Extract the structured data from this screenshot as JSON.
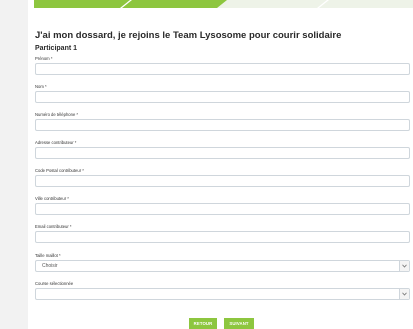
{
  "colors": {
    "accent": "#8dc63f",
    "progress_track": "#eef3e8",
    "page_background": "#f2f2f2",
    "card_background": "#ffffff",
    "input_border": "#cfd6dc"
  },
  "form": {
    "title": "J'ai mon dossard, je rejoins le Team Lysosome pour courir solidaire",
    "participant_heading": "Participant 1",
    "fields": [
      {
        "label": "Prénom *",
        "value": ""
      },
      {
        "label": "Nom *",
        "value": ""
      },
      {
        "label": "Numéro de téléphone *",
        "value": ""
      },
      {
        "label": "Adresse contributeur *",
        "value": ""
      },
      {
        "label": "Code Postal contributeur *",
        "value": ""
      },
      {
        "label": "Ville contributeur *",
        "value": ""
      },
      {
        "label": "Email contributeur *",
        "value": ""
      }
    ],
    "tshirt": {
      "label": "Taille maillot *",
      "selected": "Choisir",
      "icon": "chevron-down-icon"
    },
    "course": {
      "label": "Course sélectionnée",
      "selected": "",
      "icon": "chevron-down-icon"
    }
  },
  "buttons": {
    "back_label": "RETOUR",
    "next_label": "SUIVANT"
  }
}
